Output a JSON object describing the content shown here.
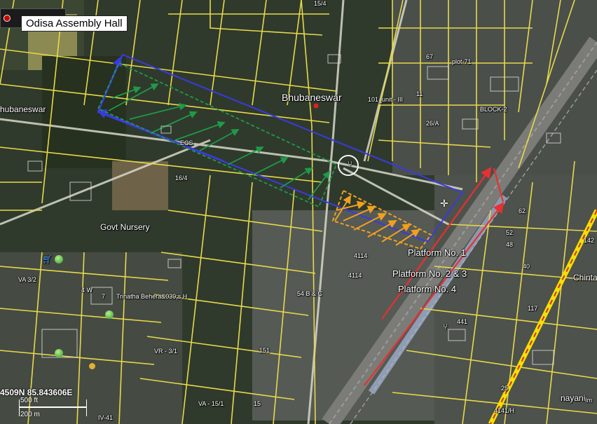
{
  "map_title": "Odisa Assembly Hall",
  "coordinates": "4509N 85.843606E",
  "scale": {
    "feet": "500 ft",
    "meters": "200 m"
  },
  "place_labels": {
    "city": "Bhubaneswar",
    "city_left_edge": "hubaneswar",
    "govt_nursery": "Govt Nursery",
    "platform_1": "Platform No. 1",
    "platform_2_3": "Platform No. 2 & 3",
    "platform_4": "Platform No. 4",
    "chinta": "Chinta",
    "nayani": "nayani",
    "trinatha": "Trinatha Behera&039;s H",
    "im": "Im"
  },
  "plot_labels": {
    "p15_4": "15/4",
    "p67": "67",
    "plot71": "plot-71",
    "unit3": "101_unit - III",
    "p11": "11",
    "block2": "BLOCK-2",
    "p26a": "26/A",
    "p165": "16/4",
    "ecs": "ECS",
    "p62": "62",
    "p52": "52",
    "p48": "48",
    "p40": "40",
    "p142": "142",
    "p117": "117",
    "p441": "441",
    "p4114a": "4114",
    "p4114b": "4114",
    "p54bc": "54 B & C",
    "p151": "151",
    "va32": "VA 3/2",
    "w4": "4  W",
    "p7": "7",
    "vr31": "VR - 3/1",
    "va151": "VA - 15/1",
    "p15": "15",
    "iv41": "IV-41",
    "p25": "25",
    "p4141h": "4141/H"
  },
  "colors": {
    "plot_boundary": "#e8d94a",
    "highway": "#f2e100",
    "highway_dash": "#d92a1a",
    "blue_outline": "#3a3ae0",
    "green_arrows": "#1f9a4a",
    "orange_arrows": "#f0a020",
    "red_arrows": "#e83030"
  },
  "icons": {
    "title_marker": "red-dot-marker-icon",
    "city_marker": "red-dot-icon",
    "restaurant": "fork-knife-icon",
    "shopping": "shopping-cart-icon",
    "park": "green-ball-icon",
    "crosshair": "crosshair-icon"
  }
}
